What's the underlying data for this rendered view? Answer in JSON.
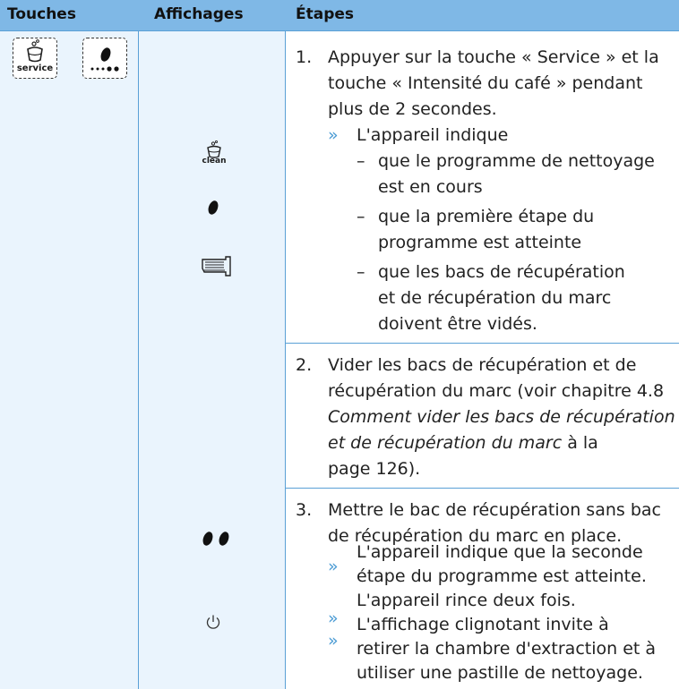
{
  "header": {
    "col1": "Touches",
    "col2": "Affichages",
    "col3": "Étapes"
  },
  "icons": {
    "service_key_label": "service",
    "clean_label": "clean",
    "service_key": "service-key-icon",
    "coffee_strength_key": "coffee-strength-key-icon",
    "one_bean": "one-bean-icon",
    "tray": "drip-tray-icon",
    "two_beans": "two-beans-icon",
    "power": "power-icon"
  },
  "steps": {
    "s1_num": "1.",
    "s1_l1": "Appuyer sur la touche « Service » et la",
    "s1_l2": "touche « Intensité du café » pendant",
    "s1_l3": "plus de 2 secondes.",
    "arrow": "»",
    "dash": "–",
    "s1_a1": "L'appareil indique",
    "s1_d1_l1": "que le programme de nettoyage",
    "s1_d1_l2": "est en cours",
    "s1_d2_l1": "que la première étape du",
    "s1_d2_l2": "programme est atteinte",
    "s1_d3_l1": "que les bacs de récupération",
    "s1_d3_l2": "et de récupération du marc",
    "s1_d3_l3": "doivent être vidés.",
    "s2_num": "2.",
    "s2_l1": "Vider les bacs de récupération et de",
    "s2_l2": "récupération du marc (voir chapitre 4.8",
    "s2_l3": "Comment vider les bacs de récupération",
    "s2_l4a": "et de récupération du marc",
    "s2_l4b": " à la",
    "s2_l5": "page 126).",
    "s3_num": "3.",
    "s3_l1": "Mettre le bac de récupération sans bac",
    "s3_l2": "de récupération du marc en place.",
    "s3_a1_l1": "L'appareil indique que la seconde",
    "s3_a1_l2": "étape du programme est atteinte.",
    "s3_a2": "L'appareil rince deux fois.",
    "s3_a3_l1": "L'affichage clignotant invite à",
    "s3_a3_l2": "retirer la chambre d'extraction et à",
    "s3_a3_l3": "utiliser une pastille de nettoyage."
  }
}
